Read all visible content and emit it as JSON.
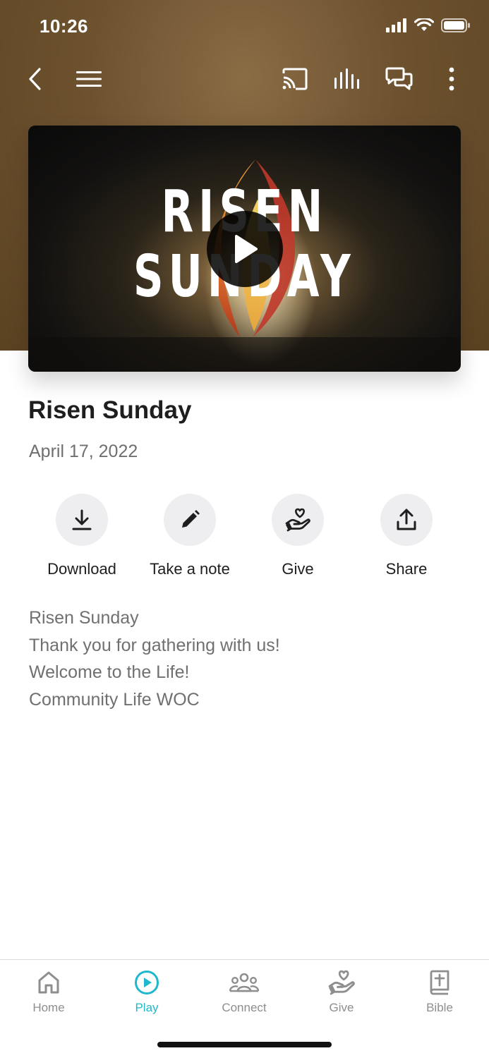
{
  "status_bar": {
    "time": "10:26"
  },
  "toolbar": {
    "back": "back-icon",
    "menu": "menu-icon",
    "cast": "cast-icon",
    "audio": "audio-bars-icon",
    "chat": "chat-icon",
    "more": "more-vertical-icon"
  },
  "video": {
    "thumbnail_text_line1": "RISEN",
    "thumbnail_text_line2": "SUNDAY"
  },
  "sermon": {
    "title": "Risen Sunday",
    "date": "April 17, 2022"
  },
  "actions": [
    {
      "label": "Download",
      "icon": "download-icon"
    },
    {
      "label": "Take a note",
      "icon": "pencil-icon"
    },
    {
      "label": "Give",
      "icon": "give-hand-heart-icon"
    },
    {
      "label": "Share",
      "icon": "share-icon"
    }
  ],
  "description": [
    "Risen Sunday",
    "Thank you for gathering with us!",
    "Welcome to the Life!",
    "Community Life WOC"
  ],
  "tabs": [
    {
      "label": "Home",
      "icon": "home-icon",
      "active": false
    },
    {
      "label": "Play",
      "icon": "play-circle-icon",
      "active": true
    },
    {
      "label": "Connect",
      "icon": "people-icon",
      "active": false
    },
    {
      "label": "Give",
      "icon": "give-hand-heart-icon",
      "active": false
    },
    {
      "label": "Bible",
      "icon": "bible-icon",
      "active": false
    }
  ],
  "colors": {
    "accent": "#20b8cc",
    "header_brown": "#6e5230",
    "inactive_tab": "#8e8e8e"
  }
}
